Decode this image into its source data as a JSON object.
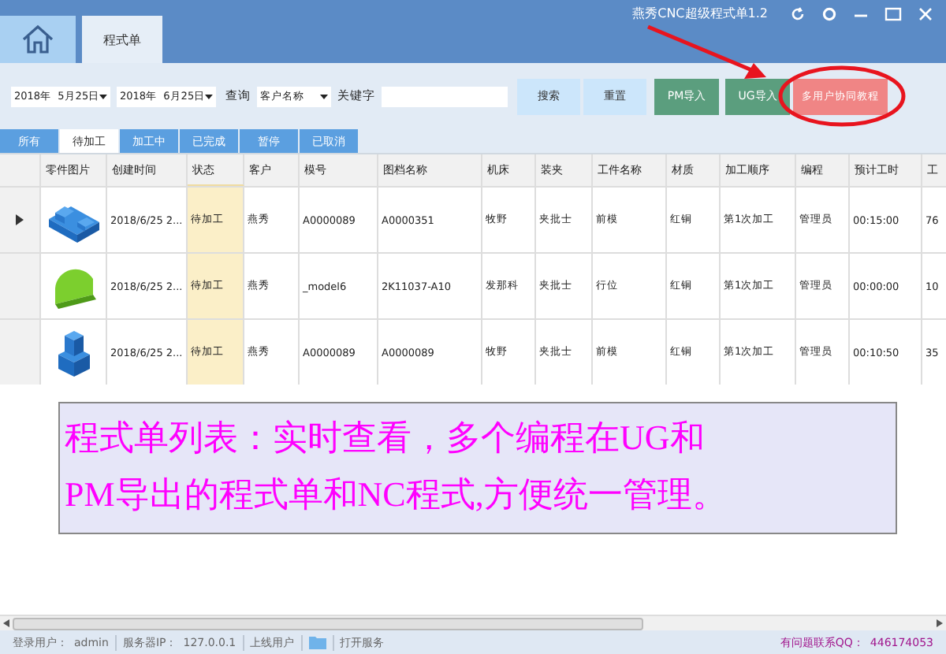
{
  "window": {
    "title": "燕秀CNC超级程式单1.2"
  },
  "nav_tabs": [
    {
      "label": "程式单",
      "selected": true
    }
  ],
  "toolbar": {
    "date_from": "2018年  5月25日",
    "date_to": "2018年  6月25日",
    "query_label": "查询",
    "query_field": "客户名称",
    "keyword_label": "关键字",
    "buttons": [
      {
        "label": "搜索",
        "kind": "plain"
      },
      {
        "label": "重置",
        "kind": "plain"
      },
      {
        "label": "PM导入",
        "kind": "import"
      },
      {
        "label": "UG导入",
        "kind": "import"
      },
      {
        "label": "多用户协同教程",
        "kind": "tutorial"
      }
    ]
  },
  "status_tabs": [
    {
      "label": "所有",
      "selected": false
    },
    {
      "label": "待加工",
      "selected": true
    },
    {
      "label": "加工中",
      "selected": false
    },
    {
      "label": "已完成",
      "selected": false
    },
    {
      "label": "暂停",
      "selected": false
    },
    {
      "label": "已取消",
      "selected": false
    }
  ],
  "table": {
    "columns": [
      {
        "label": "零件图片",
        "highlighted": false
      },
      {
        "label": "创建时间",
        "highlighted": false
      },
      {
        "label": "状态",
        "highlighted": true
      },
      {
        "label": "客户",
        "highlighted": false
      },
      {
        "label": "模号",
        "highlighted": false
      },
      {
        "label": "图档名称",
        "highlighted": false
      },
      {
        "label": "机床",
        "highlighted": false
      },
      {
        "label": "装夹",
        "highlighted": false
      },
      {
        "label": "工件名称",
        "highlighted": false
      },
      {
        "label": "材质",
        "highlighted": false
      },
      {
        "label": "加工顺序",
        "highlighted": false
      },
      {
        "label": "编程",
        "highlighted": false
      },
      {
        "label": "预计工时",
        "highlighted": false
      },
      {
        "label": "工",
        "highlighted": false
      }
    ],
    "rows": [
      {
        "current": true,
        "cells": [
          "",
          "2018/6/25 2...",
          "待加工",
          "燕秀",
          "A0000089",
          "A0000351",
          "牧野",
          "夹批士",
          "前模",
          "红铜",
          "第1次加工",
          "管理员",
          "00:15:00",
          "76"
        ]
      },
      {
        "current": false,
        "cells": [
          "",
          "2018/6/25 2...",
          "待加工",
          "燕秀",
          "_model6",
          "2K11037-A10",
          "发那科",
          "夹批士",
          "行位",
          "红铜",
          "第1次加工",
          "管理员",
          "00:00:00",
          "10"
        ]
      },
      {
        "current": false,
        "cells": [
          "",
          "2018/6/25 2...",
          "待加工",
          "燕秀",
          "A0000089",
          "A0000089",
          "牧野",
          "夹批士",
          "前模",
          "红铜",
          "第1次加工",
          "管理员",
          "00:10:50",
          "35"
        ]
      }
    ]
  },
  "annotation": {
    "text": "程式单列表：实时查看，多个编程在UG和\nPM导出的程式单和NC程式,方便统一管理。"
  },
  "status_bar": {
    "login_label": "登录用户：",
    "login_user": "admin",
    "server_label": "服务器IP：",
    "server_ip": "127.0.0.1",
    "online_label": "上线用户",
    "open_service": "打开服务",
    "contact_label": "有问题联系QQ：",
    "contact_qq": "446174053"
  }
}
